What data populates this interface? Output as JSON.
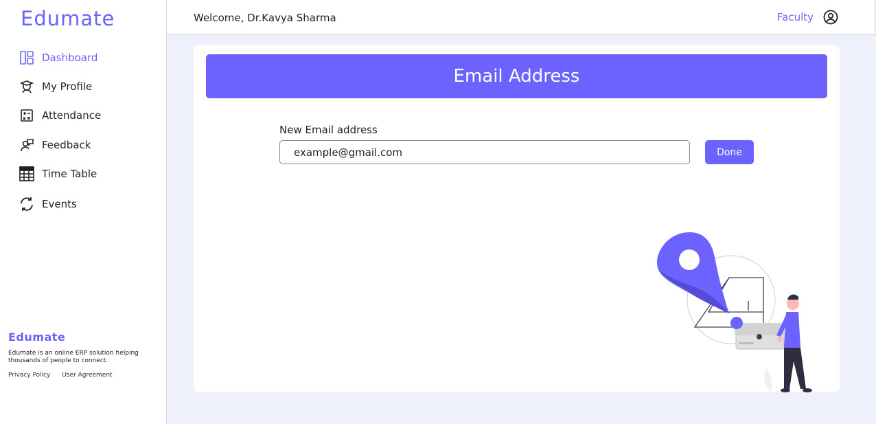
{
  "sidebar": {
    "brand": "Edumate",
    "items": [
      {
        "label": "Dashboard",
        "icon": "dashboard-icon",
        "active": true
      },
      {
        "label": "My Profile",
        "icon": "profile-icon"
      },
      {
        "label": "Attendance",
        "icon": "attendance-icon"
      },
      {
        "label": "Feedback",
        "icon": "feedback-icon"
      },
      {
        "label": "Time Table",
        "icon": "timetable-icon"
      },
      {
        "label": "Events",
        "icon": "events-icon"
      }
    ],
    "footer": {
      "brand": "Edumate",
      "description": "Edumate is an online ERP solution helping thousands of people to connect.",
      "links": [
        "Privacy Policy",
        "User Agreement"
      ]
    }
  },
  "header": {
    "welcome": "Welcome, Dr.Kavya Sharma",
    "role": "Faculty",
    "user_icon": "user-circle-icon"
  },
  "main": {
    "banner_title": "Email Address",
    "field_label": "New Email address",
    "email_value": "example@gmail.com",
    "done_label": "Done"
  },
  "colors": {
    "accent": "#6c63ff",
    "page_bg": "#eef0fc"
  }
}
